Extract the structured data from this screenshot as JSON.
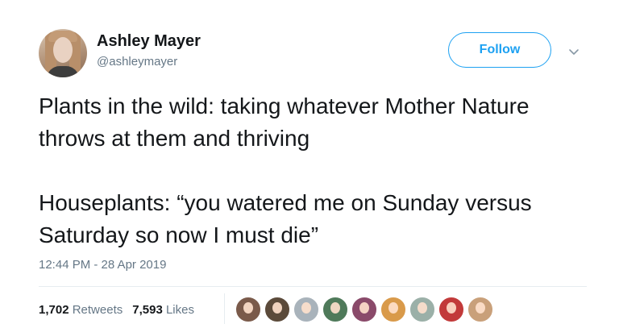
{
  "author": {
    "name": "Ashley Mayer",
    "handle": "@ashleymayer"
  },
  "follow_button": {
    "label": "Follow"
  },
  "tweet": {
    "paragraphs": [
      "Plants in the wild: taking whatever Mother Nature throws at them and thriving",
      "Houseplants: “you watered me on Sunday versus Saturday so now I must die”"
    ],
    "timestamp": "12:44 PM - 28 Apr 2019"
  },
  "stats": {
    "retweets_count": "1,702",
    "retweets_label": "Retweets",
    "likes_count": "7,593",
    "likes_label": "Likes"
  },
  "likers": {
    "colors": [
      "#7a5a4a",
      "#5b4a3a",
      "#a9b3bb",
      "#4f7a5a",
      "#8a4a6a",
      "#d99a4a",
      "#9bb0a8",
      "#c23a3a",
      "#c9a07a"
    ]
  },
  "colors": {
    "accent": "#1da1f2",
    "text": "#14171a",
    "secondary": "#657786",
    "divider": "#e6ecf0"
  }
}
